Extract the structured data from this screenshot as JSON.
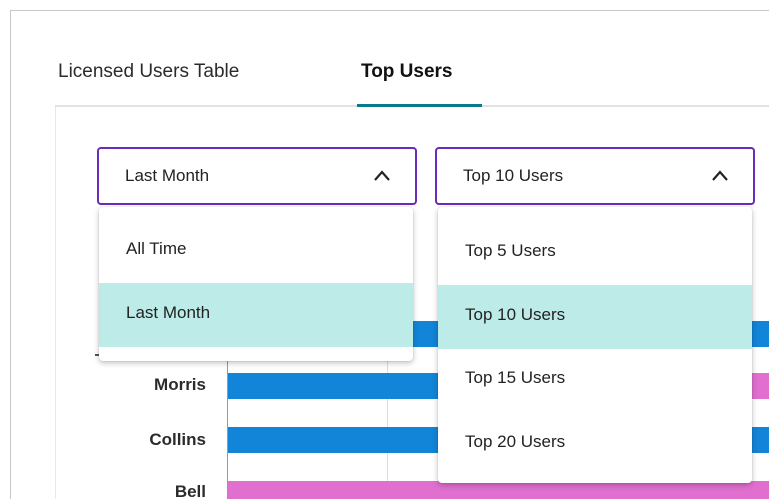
{
  "tabs": [
    {
      "label": "Licensed Users Table",
      "active": false
    },
    {
      "label": "Top Users",
      "active": true
    }
  ],
  "period_select": {
    "value": "Last Month",
    "options": [
      "All Time",
      "Last Month"
    ],
    "selected_index": 1,
    "expanded": true
  },
  "users_select": {
    "value": "Top 10 Users",
    "options": [
      "Top 5 Users",
      "Top 10 Users",
      "Top 15 Users",
      "Top 20 Users"
    ],
    "selected_index": 1,
    "expanded": true
  },
  "chart_data": {
    "type": "bar",
    "orientation": "horizontal",
    "categories": [
      "Morris",
      "Collins",
      "Bell"
    ],
    "colors": {
      "blue": "#1385d8",
      "pink": "#e06fd0"
    }
  },
  "colors": {
    "accent_border": "#6b2bb8",
    "tab_underline": "#0a7a8a",
    "selected_option": "#bdece8"
  }
}
